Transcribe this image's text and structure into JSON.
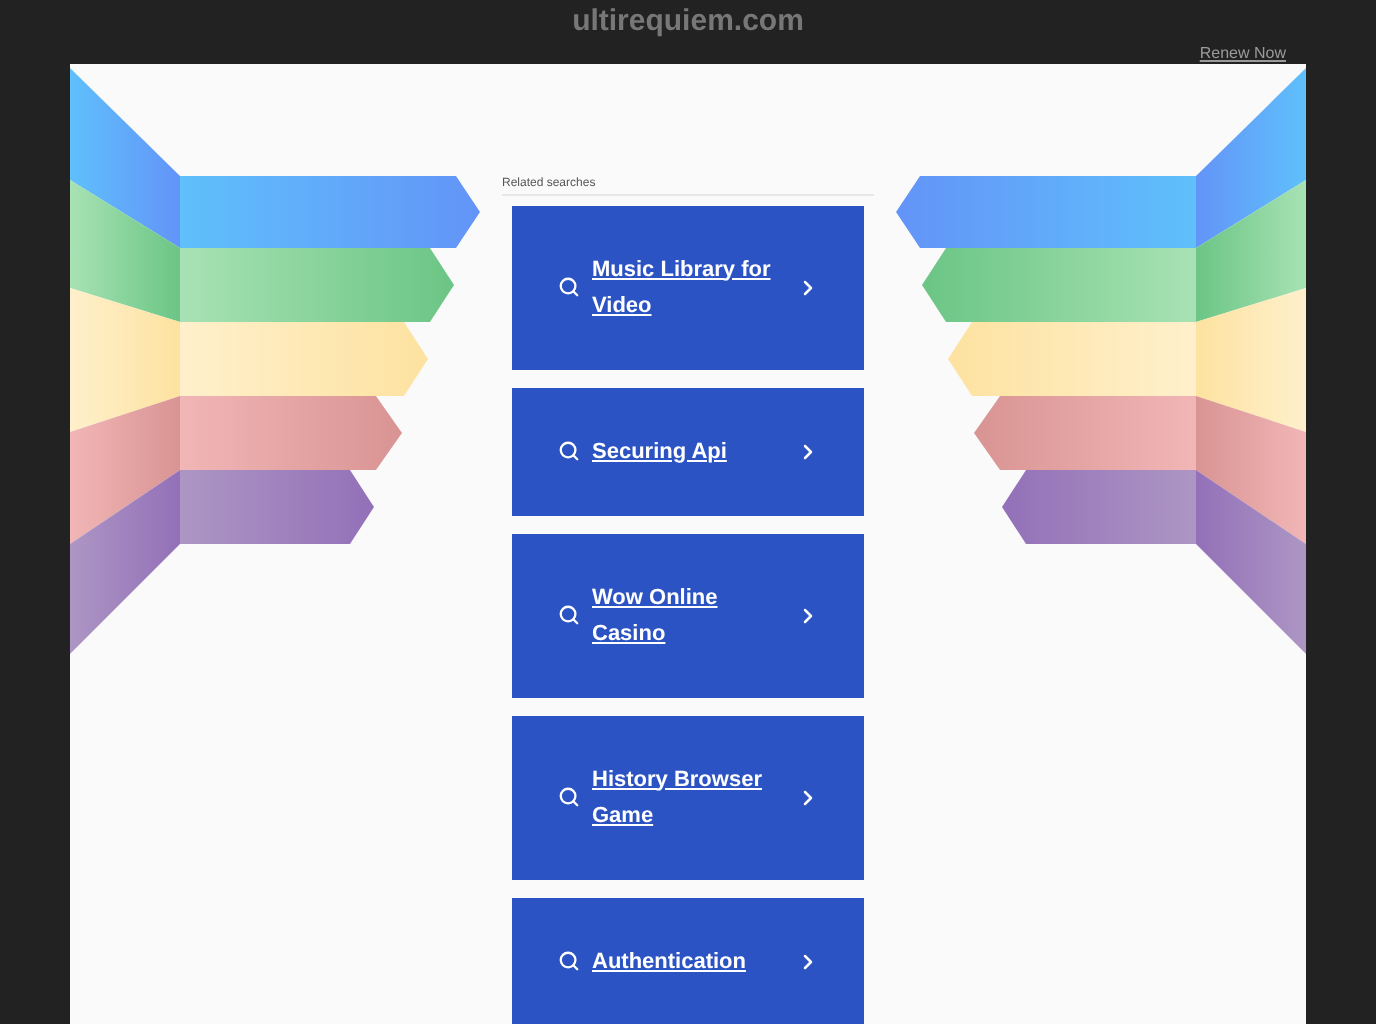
{
  "site_title": "ultirequiem.com",
  "renew_link": "Renew Now",
  "related_heading": "Related searches",
  "searches": [
    "Music Library for Video",
    "Securing Api",
    "Wow Online Casino",
    "History Browser Game",
    "Authentication"
  ]
}
